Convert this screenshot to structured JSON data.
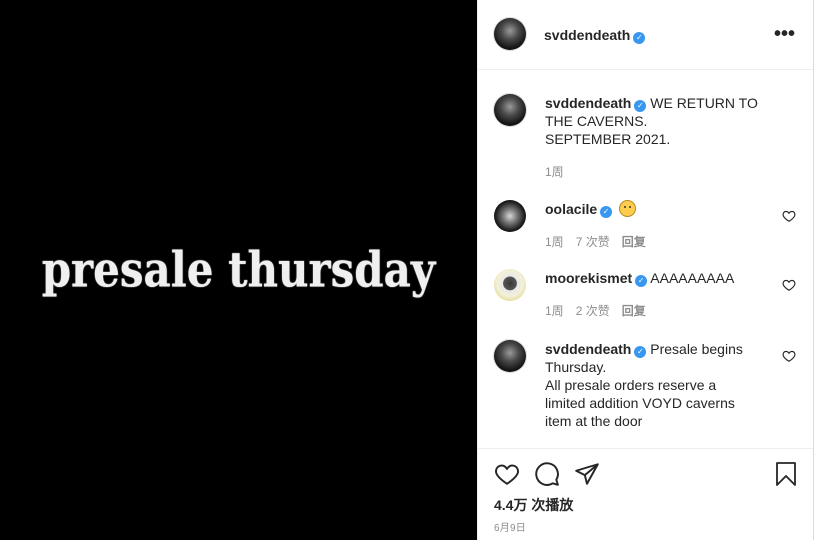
{
  "media": {
    "text": "presale thursday"
  },
  "header": {
    "username": "svddendeath",
    "more_label": "•••"
  },
  "caption": {
    "username": "svddendeath",
    "text": "WE RETURN TO THE CAVERNS.",
    "text2": "SEPTEMBER 2021.",
    "time": "1周"
  },
  "comments": [
    {
      "username": "oolacile",
      "text": "",
      "emoji": "flushed-face",
      "time": "1周",
      "likes": "7 次赞",
      "reply": "回复"
    },
    {
      "username": "moorekismet",
      "text": "AAAAAAAAA",
      "time": "1周",
      "likes": "2 次赞",
      "reply": "回复"
    },
    {
      "username": "svddendeath",
      "text": "Presale begins Thursday.",
      "text2": "All presale orders reserve a limited addition VOYD caverns item at the door"
    }
  ],
  "stats": {
    "views": "4.4万 次播放",
    "date": "6月9日"
  },
  "colors": {
    "verified": "#3897f0",
    "muted": "#8e8e8e",
    "text": "#262626"
  }
}
